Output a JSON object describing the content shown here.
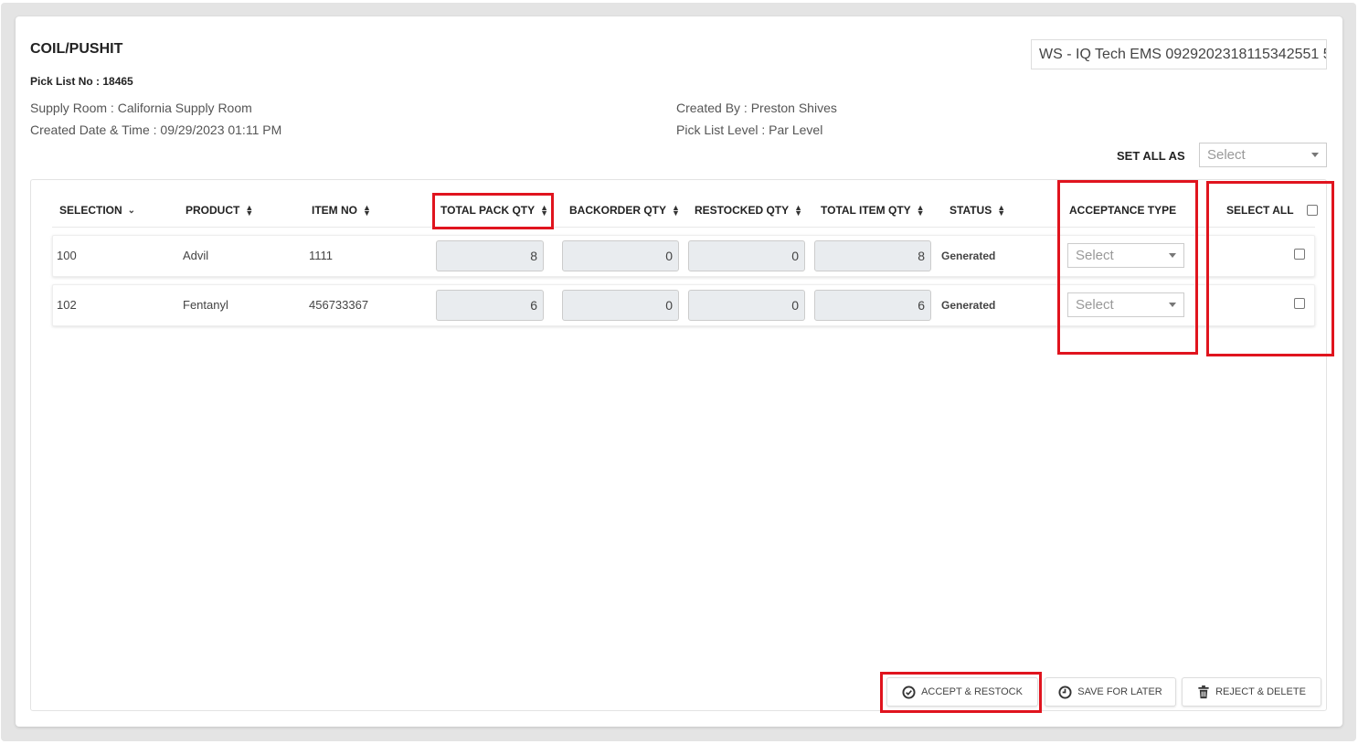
{
  "header": {
    "title": "COIL/PUSHIT",
    "pick_list_label": "Pick List No : ",
    "pick_list_no": "18465",
    "ws_value": "WS - IQ Tech EMS 0929202318115342551 5"
  },
  "meta": {
    "supply_room_label": "Supply Room : ",
    "supply_room": "California Supply Room",
    "created_date_label": "Created Date & Time : ",
    "created_date": "09/29/2023 01:11 PM",
    "created_by_label": "Created By : ",
    "created_by": "Preston Shives",
    "level_label": "Pick List Level : ",
    "level": "Par Level"
  },
  "set_all": {
    "label": "SET ALL AS",
    "placeholder": "Select"
  },
  "columns": {
    "selection": "SELECTION",
    "product": "PRODUCT",
    "item_no": "ITEM NO",
    "total_pack_qty": "TOTAL PACK QTY",
    "backorder_qty": "BACKORDER QTY",
    "restocked_qty": "RESTOCKED QTY",
    "total_item_qty": "TOTAL ITEM QTY",
    "status": "STATUS",
    "acceptance_type": "ACCEPTANCE TYPE",
    "select_all": "SELECT ALL"
  },
  "rows": [
    {
      "selection": "100",
      "product": "Advil",
      "item_no": "1111",
      "total_pack_qty": "8",
      "backorder_qty": "0",
      "restocked_qty": "0",
      "total_item_qty": "8",
      "status": "Generated",
      "acceptance": "Select"
    },
    {
      "selection": "102",
      "product": "Fentanyl",
      "item_no": "456733367",
      "total_pack_qty": "6",
      "backorder_qty": "0",
      "restocked_qty": "0",
      "total_item_qty": "6",
      "status": "Generated",
      "acceptance": "Select"
    }
  ],
  "buttons": {
    "accept": "ACCEPT & RESTOCK",
    "save": "SAVE FOR LATER",
    "reject": "REJECT & DELETE"
  },
  "colors": {
    "highlight": "#e0141e",
    "field_bg": "#e9ecef"
  }
}
